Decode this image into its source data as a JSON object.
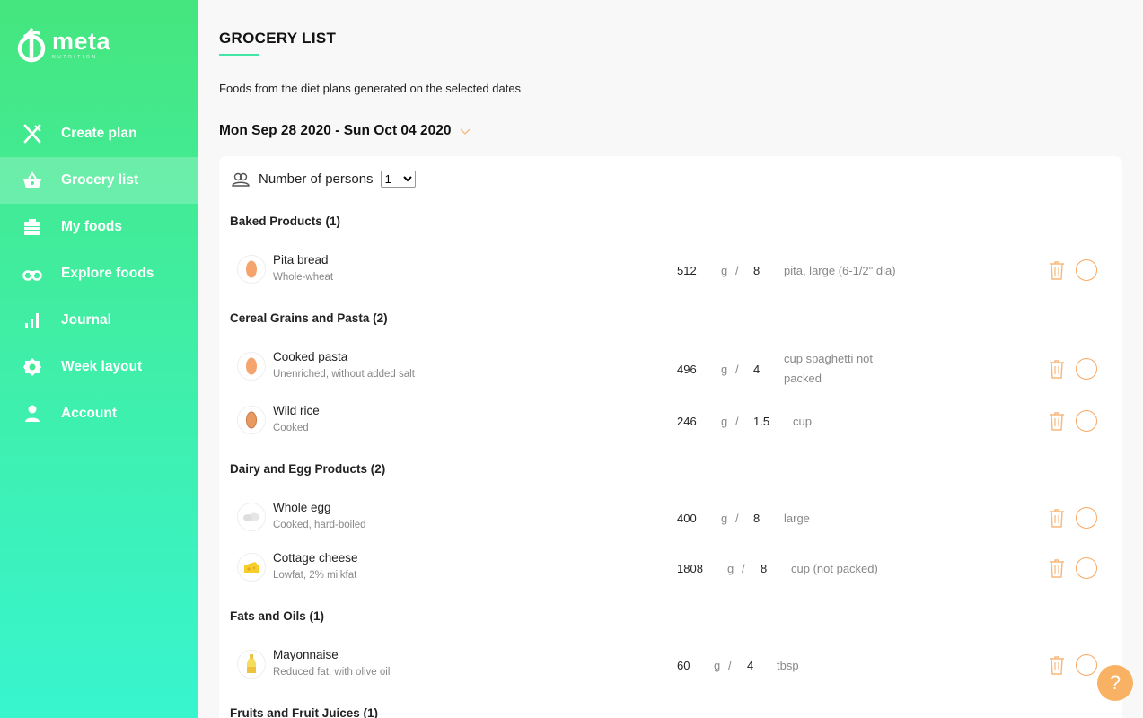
{
  "brand": {
    "name": "meta",
    "tagline": "NUTRITION"
  },
  "sidebar": {
    "items": [
      {
        "label": "Create plan",
        "icon": "utensils-icon"
      },
      {
        "label": "Grocery list",
        "icon": "basket-icon",
        "active": true
      },
      {
        "label": "My foods",
        "icon": "food-box-icon"
      },
      {
        "label": "Explore foods",
        "icon": "binoculars-icon"
      },
      {
        "label": "Journal",
        "icon": "bar-chart-icon"
      },
      {
        "label": "Week layout",
        "icon": "gear-icon"
      },
      {
        "label": "Account",
        "icon": "user-icon"
      }
    ]
  },
  "page": {
    "title": "GROCERY LIST",
    "subtitle": "Foods from the diet plans generated on the selected dates",
    "date_range": "Mon Sep 28 2020 - Sun Oct 04 2020"
  },
  "persons": {
    "label": "Number of persons",
    "value": "1",
    "options": [
      "1"
    ]
  },
  "categories": [
    {
      "label": "Baked Products (1)",
      "items": [
        {
          "name": "Pita bread",
          "sub": "Whole-wheat",
          "grams": "512",
          "g": "g",
          "sep": "/",
          "qty": "8",
          "unit": "pita, large (6-1/2\" dia)"
        }
      ]
    },
    {
      "label": "Cereal Grains and Pasta (2)",
      "items": [
        {
          "name": "Cooked pasta",
          "sub": "Unenriched, without added salt",
          "grams": "496",
          "g": "g",
          "sep": "/",
          "qty": "4",
          "unit": "cup spaghetti not",
          "unit2": "packed"
        },
        {
          "name": "Wild rice",
          "sub": "Cooked",
          "grams": "246",
          "g": "g",
          "sep": "/",
          "qty": "1.5",
          "unit": "cup"
        }
      ]
    },
    {
      "label": "Dairy and Egg Products (2)",
      "items": [
        {
          "name": "Whole egg",
          "sub": "Cooked, hard-boiled",
          "grams": "400",
          "g": "g",
          "sep": "/",
          "qty": "8",
          "unit": "large"
        },
        {
          "name": "Cottage cheese",
          "sub": "Lowfat, 2% milkfat",
          "grams": "1808",
          "g": "g",
          "sep": "/",
          "qty": "8",
          "unit": "cup (not packed)"
        }
      ]
    },
    {
      "label": "Fats and Oils (1)",
      "items": [
        {
          "name": "Mayonnaise",
          "sub": "Reduced fat, with olive oil",
          "grams": "60",
          "g": "g",
          "sep": "/",
          "qty": "4",
          "unit": "tbsp"
        }
      ]
    },
    {
      "label": "Fruits and Fruit Juices (1)",
      "items": []
    }
  ],
  "help": {
    "label": "?"
  },
  "colors": {
    "accent": "#3fe6a4",
    "orange": "#f7a865",
    "sidebar_top": "#45e67e",
    "sidebar_bottom": "#38f5cf"
  }
}
